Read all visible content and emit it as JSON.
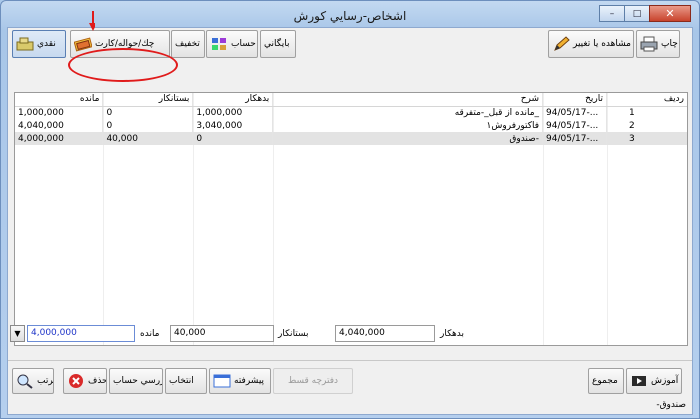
{
  "window": {
    "title": "اشخاص-رسايي كورش",
    "minimize": "–",
    "maximize": "□",
    "close": "✕"
  },
  "toolbar": {
    "naqdi": "نقدي",
    "cheque_card": "چك/حواله/كارت",
    "discount": "تخفيف",
    "account_detail": "ريز حساب",
    "archive": "بايگاني",
    "view_edit": "مشاهده يا تغيير",
    "print": "چاپ"
  },
  "grid": {
    "headers": {
      "index": "رديف",
      "date": "تاريخ",
      "desc": "شرح",
      "debit": "بدهكار",
      "credit": "بستانكار",
      "balance": "مانده"
    },
    "rows": [
      {
        "index": "1",
        "date": "94/05/17-...",
        "desc": "مانده از قبل_-متفرقه_",
        "debit": "1,000,000",
        "credit": "0",
        "balance": "1,000,000"
      },
      {
        "index": "2",
        "date": "94/05/17-...",
        "desc": "فاكتورفروش١",
        "debit": "3,040,000",
        "credit": "0",
        "balance": "4,040,000"
      },
      {
        "index": "3",
        "date": "94/05/17-...",
        "desc": "صندوق-",
        "debit": "0",
        "credit": "40,000",
        "balance": "4,000,000"
      }
    ]
  },
  "totals": {
    "debit_label": "بدهكار",
    "debit_value": "4,040,000",
    "credit_label": "بستانكار",
    "credit_value": "40,000",
    "balance_label": "مانده",
    "balance_value": "4,000,000"
  },
  "bottom_toolbar": {
    "training": "آموزش",
    "total": "مجموع",
    "cheque_book": "دفترچه قسط",
    "advanced": "پيشرفته",
    "select": "انتخاب",
    "review_account": "بررسي حساب",
    "delete": "حذف",
    "sort": "مرتب"
  },
  "status": {
    "text": "-صندوق"
  }
}
